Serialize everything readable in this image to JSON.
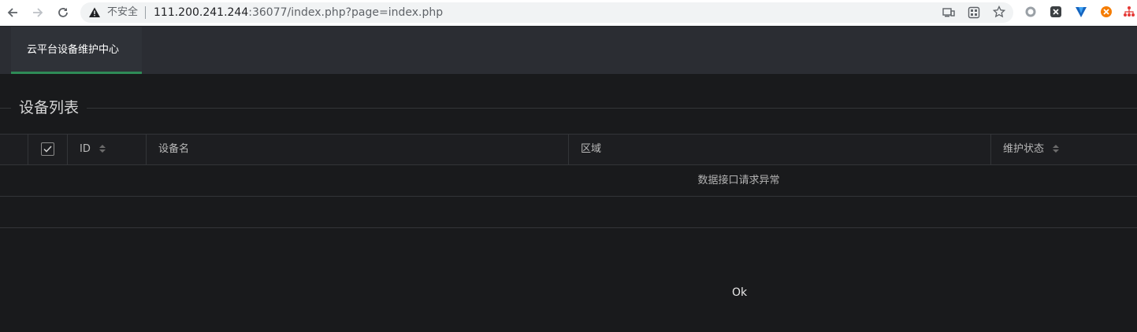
{
  "browser": {
    "security_label": "不安全",
    "url_host": "111.200.241.244",
    "url_rest": ":36077/index.php?page=index.php",
    "icons": [
      "back-icon",
      "forward-icon",
      "reload-icon",
      "warning-icon",
      "cast-icon",
      "qr-code-icon",
      "star-icon",
      "extension-circle-icon",
      "extension-x-icon",
      "extension-v-icon",
      "extension-orange-icon",
      "extension-tree-icon"
    ]
  },
  "app": {
    "nav_tab": "云平台设备维护中心",
    "accent_color": "#2e8b57"
  },
  "main": {
    "section_title": "设备列表",
    "table": {
      "columns": [
        "ID",
        "设备名",
        "区域",
        "维护状态"
      ],
      "empty_message": "数据接口请求异常"
    },
    "footer_text": "Ok"
  }
}
